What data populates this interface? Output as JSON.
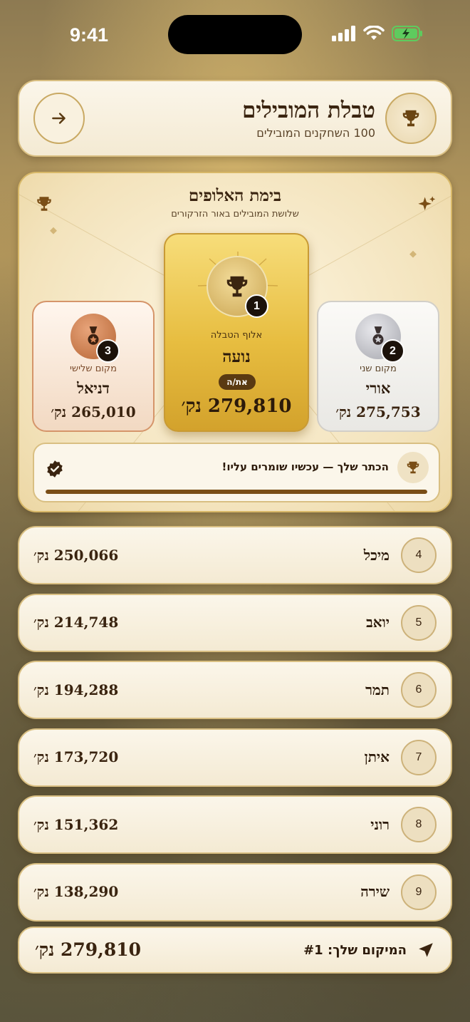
{
  "status": {
    "time": "9:41"
  },
  "header": {
    "title": "טבלת המובילים",
    "subtitle": "100 השחקנים המובילים"
  },
  "podium": {
    "title": "בימת האלופים",
    "subtitle": "שלושת המובילים באור הזרקורים",
    "first": {
      "label": "אלוף הטבלה",
      "name": "נועה",
      "score": "279,810 נק׳",
      "rank": "1",
      "you": "את/ה"
    },
    "second": {
      "label": "מקום שני",
      "name": "אורי",
      "score": "275,753 נק׳",
      "rank": "2"
    },
    "third": {
      "label": "מקום שלישי",
      "name": "דניאל",
      "score": "265,010 נק׳",
      "rank": "3"
    },
    "crown_message": "הכתר שלך — עכשיו שומרים עליו!",
    "progress": 1.0
  },
  "rows": [
    {
      "rank": "4",
      "name": "מיכל",
      "score": "250,066 נק׳"
    },
    {
      "rank": "5",
      "name": "יואב",
      "score": "214,748 נק׳"
    },
    {
      "rank": "6",
      "name": "תמר",
      "score": "194,288 נק׳"
    },
    {
      "rank": "7",
      "name": "איתן",
      "score": "173,720 נק׳"
    },
    {
      "rank": "8",
      "name": "רוני",
      "score": "151,362 נק׳"
    },
    {
      "rank": "9",
      "name": "שירה",
      "score": "138,290 נק׳"
    }
  ],
  "footer": {
    "label": "המיקום שלך: #1",
    "score": "279,810 נק׳"
  },
  "colors": {
    "accent": "#7a4e16",
    "gold": "#e7bd40",
    "silver": "#bfc0c6",
    "bronze": "#c77a45"
  }
}
